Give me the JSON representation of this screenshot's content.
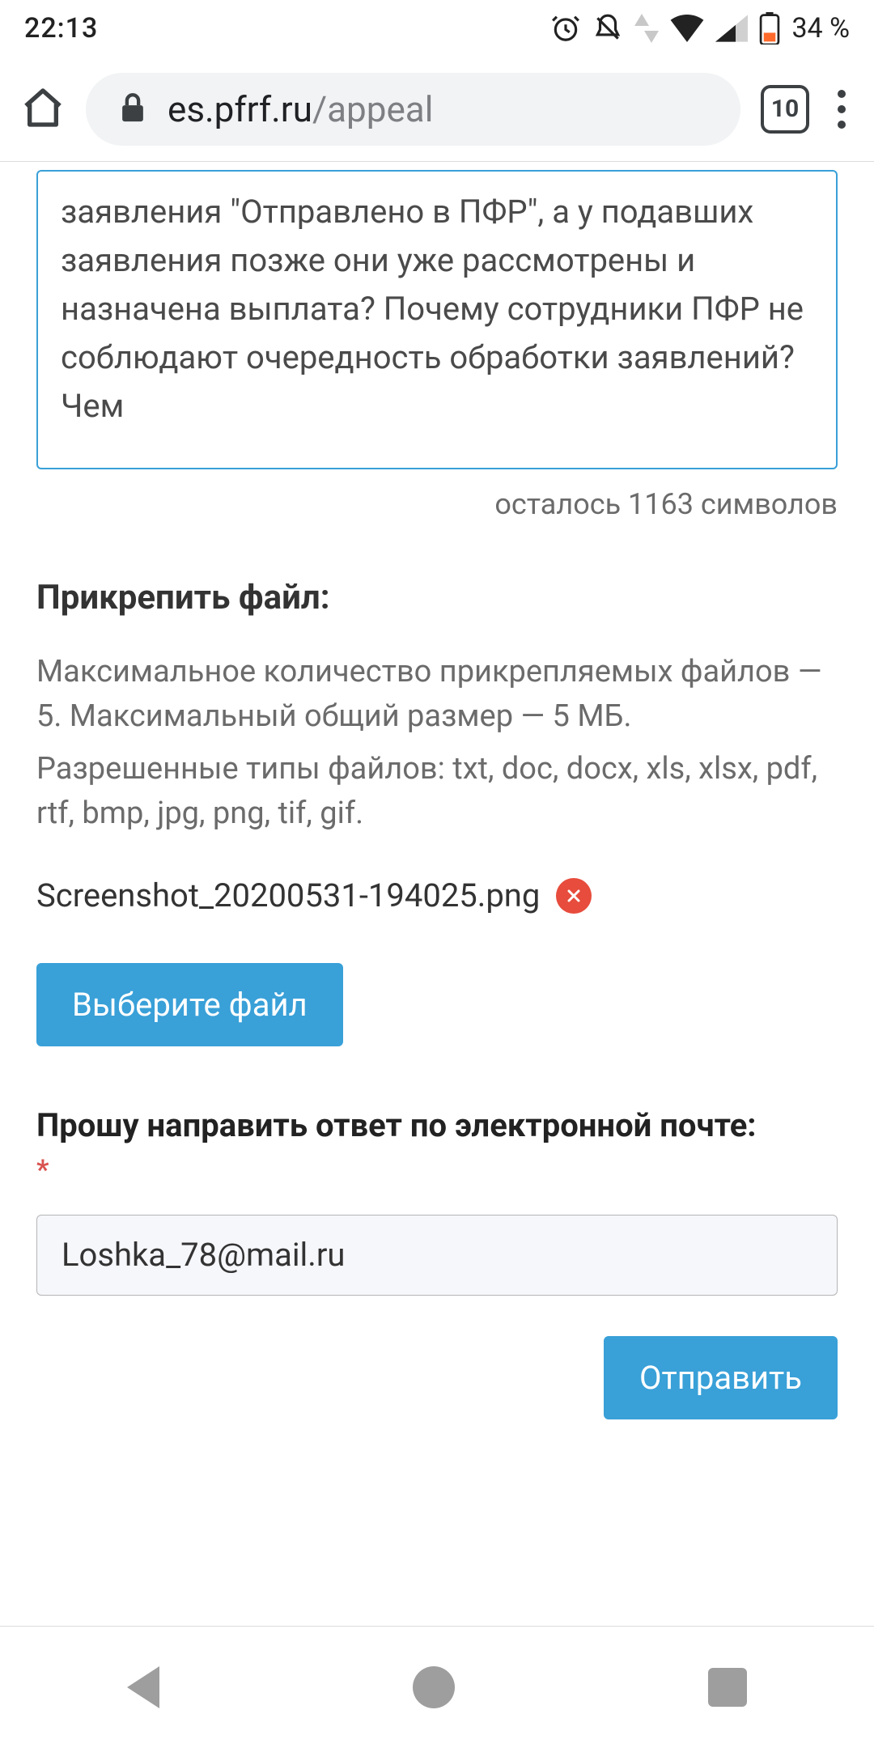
{
  "status": {
    "time": "22:13",
    "battery_pct": "34 %"
  },
  "browser": {
    "host": "es.pfrf.ru",
    "path": "/appeal",
    "tab_count": "10"
  },
  "form": {
    "appeal_text": "заявления \"Отправлено в ПФР\", а у подавших заявления позже они уже рассмотрены и назначена выплата? Почему сотрудники ПФР не соблюдают очередность обработки заявлений? Чем",
    "char_counter": "осталось 1163 символов",
    "attach_heading": "Прикрепить файл:",
    "attach_hint_1": "Максимальное количество прикрепляемых файлов — 5. Максимальный общий размер — 5 МБ.",
    "attach_hint_2": "Разрешенные типы файлов: txt, doc, docx, xls, xlsx, pdf, rtf, bmp, jpg, png, tif, gif.",
    "attached_file": "Screenshot_20200531-194025.png",
    "choose_file_label": "Выберите файл",
    "email_label": "Прошу направить ответ по электронной почте:",
    "required_mark": "*",
    "email_value": "Loshka_78@mail.ru",
    "submit_label": "Отправить"
  }
}
